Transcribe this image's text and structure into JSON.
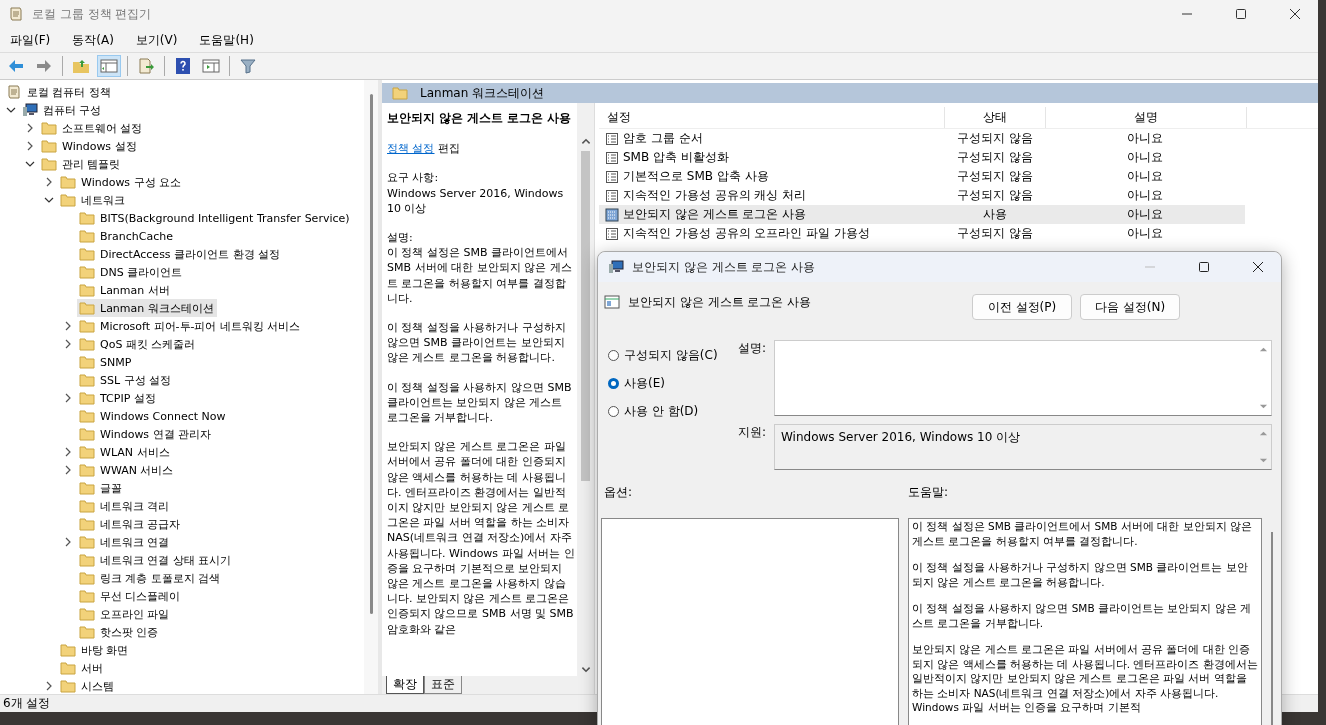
{
  "window": {
    "title": "로컬 그룹 정책 편집기"
  },
  "menu": [
    {
      "label": "파일(F)"
    },
    {
      "label": "동작(A)"
    },
    {
      "label": "보기(V)"
    },
    {
      "label": "도움말(H)"
    }
  ],
  "toolbar": [
    {
      "kind": "back",
      "pressed": false
    },
    {
      "kind": "forward",
      "pressed": false
    },
    {
      "kind": "sep"
    },
    {
      "kind": "up",
      "pressed": false
    },
    {
      "kind": "tree",
      "pressed": true
    },
    {
      "kind": "sep"
    },
    {
      "kind": "export",
      "pressed": false
    },
    {
      "kind": "sep"
    },
    {
      "kind": "help",
      "pressed": false
    },
    {
      "kind": "view",
      "pressed": false
    },
    {
      "kind": "sep"
    },
    {
      "kind": "filter",
      "pressed": false
    }
  ],
  "tree": [
    {
      "label": "로컬 컴퓨터 정책",
      "selected": false,
      "children": [
        {
          "label": "컴퓨터 구성",
          "expanded": true,
          "selected": false,
          "children": [
            {
              "label": "소프트웨어 설정",
              "expanded": false,
              "selected": false
            },
            {
              "label": "Windows 설정",
              "expanded": false,
              "selected": false
            },
            {
              "label": "관리 템플릿",
              "expanded": true,
              "selected": false,
              "children": [
                {
                  "label": "Windows 구성 요소",
                  "expanded": false,
                  "selected": false
                },
                {
                  "label": "네트워크",
                  "expanded": true,
                  "selected": false,
                  "children": [
                    {
                      "label": "BITS(Background Intelligent Transfer Service)",
                      "selected": false
                    },
                    {
                      "label": "BranchCache",
                      "selected": false
                    },
                    {
                      "label": "DirectAccess 클라이언트 환경 설정",
                      "selected": false
                    },
                    {
                      "label": "DNS 클라이언트",
                      "selected": false
                    },
                    {
                      "label": "Lanman 서버",
                      "selected": false
                    },
                    {
                      "label": "Lanman 워크스테이션",
                      "selected": true
                    },
                    {
                      "label": "Microsoft 피어-투-피어 네트워킹 서비스",
                      "expanded": false,
                      "selected": false
                    },
                    {
                      "label": "QoS 패킷 스케줄러",
                      "expanded": false,
                      "selected": false
                    },
                    {
                      "label": "SNMP",
                      "selected": false
                    },
                    {
                      "label": "SSL 구성 설정",
                      "selected": false
                    },
                    {
                      "label": "TCPIP 설정",
                      "expanded": false,
                      "selected": false
                    },
                    {
                      "label": "Windows Connect Now",
                      "selected": false
                    },
                    {
                      "label": "Windows 연결 관리자",
                      "selected": false
                    },
                    {
                      "label": "WLAN 서비스",
                      "expanded": false,
                      "selected": false
                    },
                    {
                      "label": "WWAN 서비스",
                      "expanded": false,
                      "selected": false
                    },
                    {
                      "label": "글꼴",
                      "selected": false
                    },
                    {
                      "label": "네트워크 격리",
                      "selected": false
                    },
                    {
                      "label": "네트워크 공급자",
                      "selected": false
                    },
                    {
                      "label": "네트워크 연결",
                      "expanded": false,
                      "selected": false
                    },
                    {
                      "label": "네트워크 연결 상태 표시기",
                      "selected": false
                    },
                    {
                      "label": "링크 계층 토폴로지 검색",
                      "selected": false
                    },
                    {
                      "label": "무선 디스플레이",
                      "selected": false
                    },
                    {
                      "label": "오프라인 파일",
                      "selected": false
                    },
                    {
                      "label": "핫스팟 인증",
                      "selected": false
                    }
                  ]
                },
                {
                  "label": "바탕 화면",
                  "selected": false
                },
                {
                  "label": "서버",
                  "selected": false
                },
                {
                  "label": "시스템",
                  "expanded": false,
                  "selected": false
                }
              ]
            }
          ]
        }
      ]
    }
  ],
  "pane_header": "Lanman 워크스테이션",
  "extended_view": {
    "title": "보안되지 않은 게스트 로그온 사용",
    "link": "정책 설정",
    "link_suffix": "편집",
    "requirements_label": "요구 사항:",
    "requirements": "Windows Server 2016, Windows 10 이상",
    "description_label": "설명:",
    "paragraphs": [
      "이 정책 설정은 SMB 클라이언트에서 SMB 서버에 대한 보안되지 않은 게스트 로그온을 허용할지 여부를 결정합니다.",
      "이 정책 설정을 사용하거나 구성하지 않으면 SMB 클라이언트는 보안되지 않은 게스트 로그온을 허용합니다.",
      "이 정책 설정을 사용하지 않으면 SMB 클라이언트는 보안되지 않은 게스트 로그온을 거부합니다.",
      "보안되지 않은 게스트 로그온은 파일 서버에서 공유 폴더에 대한 인증되지 않은 액세스를 허용하는 데 사용됩니다. 엔터프라이즈 환경에서는 일반적이지 않지만 보안되지 않은 게스트 로그온은 파일 서버 역할을 하는 소비자 NAS(네트워크 연결 저장소)에서 자주 사용됩니다. Windows 파일 서버는 인증을 요구하며 기본적으로 보안되지 않은 게스트 로그온을 사용하지 않습니다. 보안되지 않은 게스트 로그온은 인증되지 않으므로 SMB 서명 및 SMB 암호화와 같은"
    ]
  },
  "view_tabs": [
    {
      "label": "확장",
      "selected": true
    },
    {
      "label": "표준",
      "selected": false
    }
  ],
  "table": {
    "columns": [
      "설정",
      "상태",
      "설명"
    ],
    "rows": [
      {
        "cells": [
          "암호 그룹 순서",
          "구성되지 않음",
          "아니요"
        ],
        "selected": false
      },
      {
        "cells": [
          "SMB 압축 비활성화",
          "구성되지 않음",
          "아니요"
        ],
        "selected": false
      },
      {
        "cells": [
          "기본적으로 SMB 압축 사용",
          "구성되지 않음",
          "아니요"
        ],
        "selected": false
      },
      {
        "cells": [
          "지속적인 가용성 공유의 캐싱 처리",
          "구성되지 않음",
          "아니요"
        ],
        "selected": false
      },
      {
        "cells": [
          "보안되지 않은 게스트 로그온 사용",
          "사용",
          "아니요"
        ],
        "selected": true
      },
      {
        "cells": [
          "지속적인 가용성 공유의 오프라인 파일 가용성",
          "구성되지 않음",
          "아니요"
        ],
        "selected": false
      }
    ]
  },
  "status_bar": "6개 설정",
  "dialog": {
    "title": "보안되지 않은 게스트 로그온 사용",
    "policy": "보안되지 않은 게스트 로그온 사용",
    "buttons": [
      "이전 설정(P)",
      "다음 설정(N)"
    ],
    "options": [
      {
        "label": "구성되지 않음(C)",
        "selected": false
      },
      {
        "label": "사용(E)",
        "selected": true
      },
      {
        "label": "사용 안 함(D)",
        "selected": false
      }
    ],
    "comment_label": "설명:",
    "supported_label": "지원:",
    "supported": "Windows Server 2016, Windows 10 이상",
    "options_label": "옵션:",
    "help_label": "도움말:",
    "help": [
      "이 정책 설정은 SMB 클라이언트에서 SMB 서버에 대한 보안되지 않은 게스트 로그온을 허용할지 여부를 결정합니다.",
      "이 정책 설정을 사용하거나 구성하지 않으면 SMB 클라이언트는 보안되지 않은 게스트 로그온을 허용합니다.",
      "이 정책 설정을 사용하지 않으면 SMB 클라이언트는 보안되지 않은 게스트 로그온을 거부합니다.",
      "보안되지 않은 게스트 로그온은 파일 서버에서 공유 폴더에 대한 인증되지 않은 액세스를 허용하는 데 사용됩니다. 엔터프라이즈 환경에서는 일반적이지 않지만 보안되지 않은 게스트 로그온은 파일 서버 역할을 하는 소비자 NAS(네트워크 연결 저장소)에서 자주 사용됩니다. Windows 파일 서버는 인증을 요구하며 기본적"
    ]
  }
}
